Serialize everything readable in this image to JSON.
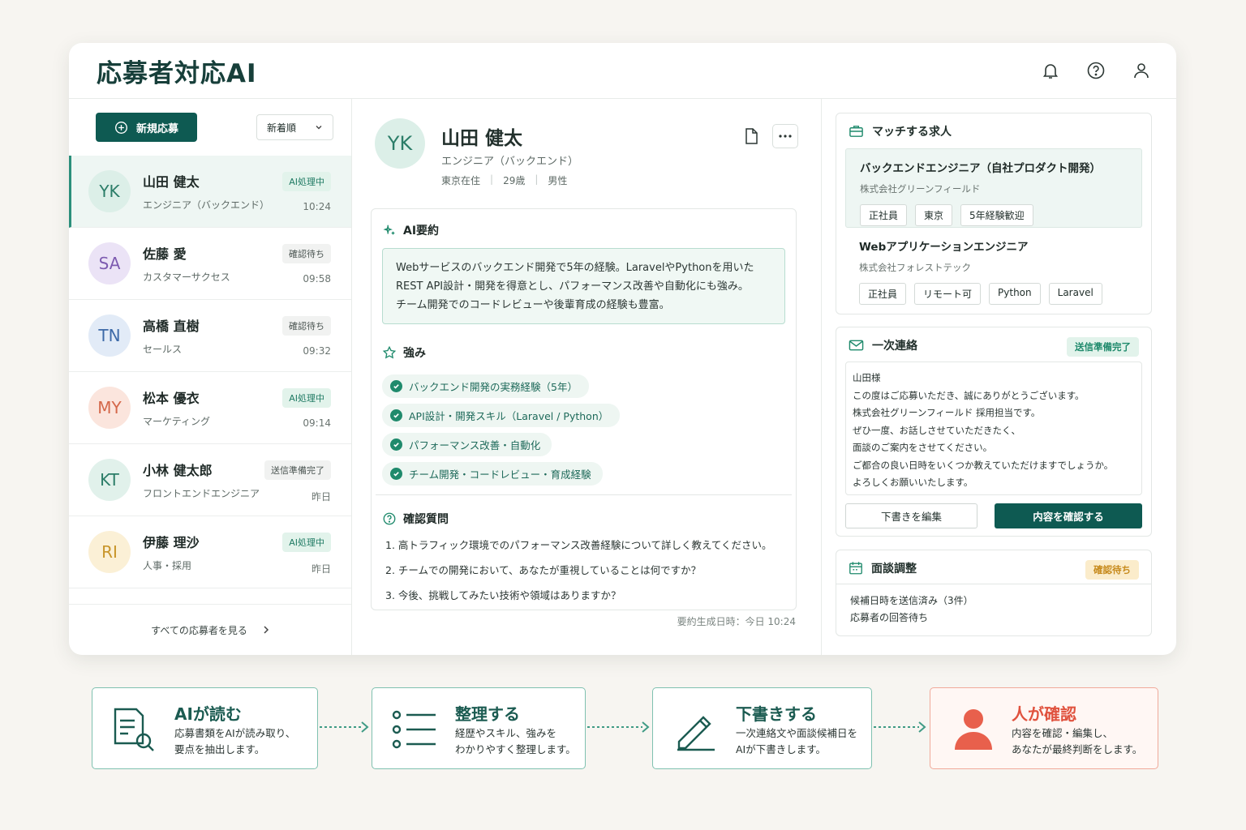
{
  "app": {
    "title": "応募者対応AI"
  },
  "header_icons": [
    "bell-icon",
    "help-icon",
    "user-icon"
  ],
  "left": {
    "new_button": "新規応募",
    "sort": "新着順",
    "candidates": [
      {
        "initials": "YK",
        "name": "山田 健太",
        "role": "エンジニア（バックエンド）",
        "status": "AI処理中",
        "time": "10:24",
        "active": true
      },
      {
        "initials": "SA",
        "name": "佐藤 愛",
        "role": "カスタマーサクセス",
        "status": "確認待ち",
        "time": "09:58"
      },
      {
        "initials": "TN",
        "name": "高橋 直樹",
        "role": "セールス",
        "status": "確認待ち",
        "time": "09:32"
      },
      {
        "initials": "MY",
        "name": "松本 優衣",
        "role": "マーケティング",
        "status": "AI処理中",
        "time": "09:14"
      },
      {
        "initials": "KT",
        "name": "小林 健太郎",
        "role": "フロントエンドエンジニア",
        "status": "送信準備完了",
        "time": "昨日"
      },
      {
        "initials": "RI",
        "name": "伊藤 理沙",
        "role": "人事・採用",
        "status": "AI処理中",
        "time": "昨日"
      }
    ],
    "see_all": "すべての応募者を見る"
  },
  "profile": {
    "initials": "YK",
    "name": "山田 健太",
    "role": "エンジニア（バックエンド）",
    "location": "東京在住",
    "age": "29歳",
    "gender": "男性"
  },
  "summary": {
    "title": "AI要約",
    "lines": [
      "Webサービスのバックエンド開発で5年の経験。LaravelやPythonを用いた",
      "REST API設計・開発を得意とし、パフォーマンス改善や自動化にも強み。",
      "チーム開発でのコードレビューや後輩育成の経験も豊富。"
    ]
  },
  "strengths": {
    "title": "強み",
    "items": [
      "バックエンド開発の実務経験（5年）",
      "API設計・開発スキル（Laravel / Python）",
      "パフォーマンス改善・自動化",
      "チーム開発・コードレビュー・育成経験"
    ]
  },
  "questions": {
    "title": "確認質問",
    "items": [
      "1.  高トラフィック環境でのパフォーマンス改善経験について詳しく教えてください。",
      "2.  チームでの開発において、あなたが重視していることは何ですか？",
      "3.  今後、挑戦してみたい技術や領域はありますか？"
    ]
  },
  "generated": "要約生成日時：今日 10:24",
  "jobs": {
    "title": "マッチする求人",
    "items": [
      {
        "title": "バックエンドエンジニア（自社プロダクト開発）",
        "company": "株式会社グリーンフィールド",
        "tags": [
          "正社員",
          "東京",
          "5年経験歓迎"
        ]
      },
      {
        "title": "Webアプリケーションエンジニア",
        "company": "株式会社フォレストテック",
        "tags": [
          "正社員",
          "リモート可",
          "Python",
          "Laravel"
        ]
      }
    ]
  },
  "contact": {
    "title": "一次連絡",
    "status": "送信準備完了",
    "lines": [
      "山田様",
      "この度はご応募いただき、誠にありがとうございます。",
      "株式会社グリーンフィールド 採用担当です。",
      "ぜひ一度、お話しさせていただきたく、",
      "面談のご案内をさせてください。",
      "ご都合の良い日時をいくつか教えていただけますでしょうか。",
      "よろしくお願いいたします。"
    ],
    "edit_button": "下書きを編集",
    "confirm_button": "内容を確認する"
  },
  "interview": {
    "title": "面談調整",
    "status": "確認待ち",
    "lines": [
      "候補日時を送信済み（3件）",
      "応募者の回答待ち"
    ]
  },
  "flow": [
    {
      "title": "AIが読む",
      "desc": [
        "応募書類をAIが読み取り、",
        "要点を抽出します。"
      ],
      "icon": "document-search-icon"
    },
    {
      "title": "整理する",
      "desc": [
        "経歴やスキル、強みを",
        "わかりやすく整理します。"
      ],
      "icon": "list-icon"
    },
    {
      "title": "下書きする",
      "desc": [
        "一次連絡文や面談候補日を",
        "AIが下書きします。"
      ],
      "icon": "pencil-icon"
    },
    {
      "title": "人が確認",
      "desc": [
        "内容を確認・編集し、",
        "あなたが最終判断をします。"
      ],
      "icon": "person-icon"
    }
  ],
  "colors": {
    "primary": "#0e5a52",
    "accent": "#1f8a6c",
    "human": "#e8604c"
  }
}
